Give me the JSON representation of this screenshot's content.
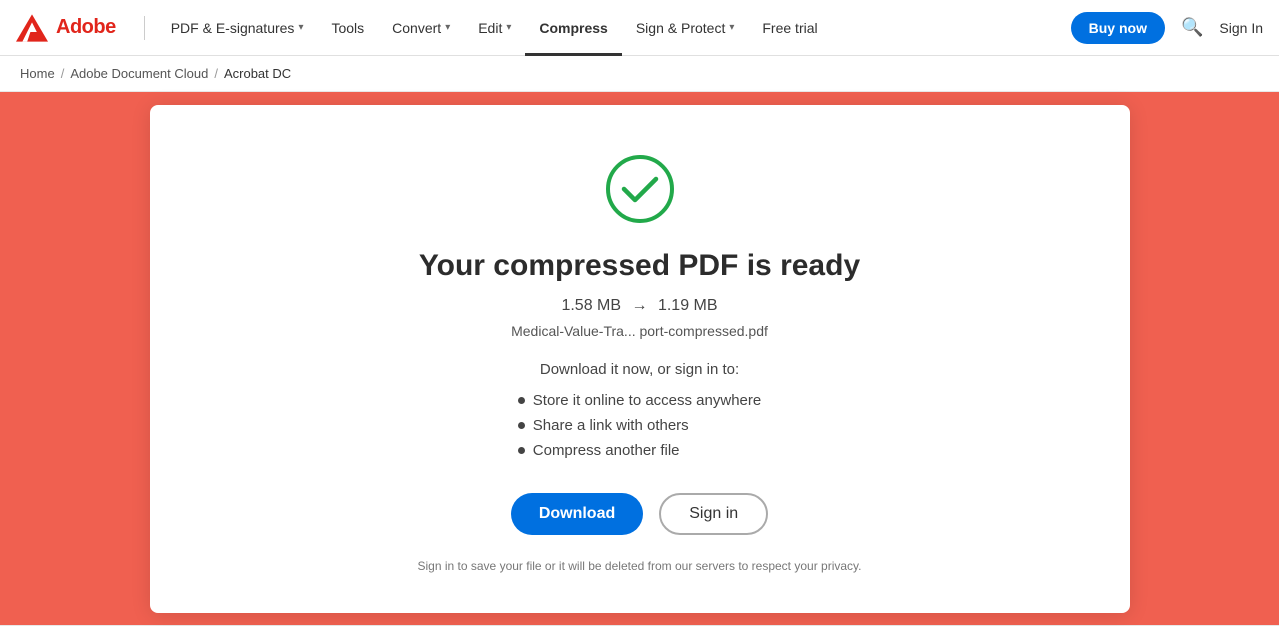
{
  "brand": {
    "adobe_icon_alt": "Adobe",
    "wordmark": "Adobe"
  },
  "navbar": {
    "items": [
      {
        "label": "PDF & E-signatures",
        "has_dropdown": true,
        "active": false
      },
      {
        "label": "Tools",
        "has_dropdown": false,
        "active": false
      },
      {
        "label": "Convert",
        "has_dropdown": true,
        "active": false
      },
      {
        "label": "Edit",
        "has_dropdown": true,
        "active": false
      },
      {
        "label": "Compress",
        "has_dropdown": false,
        "active": true
      },
      {
        "label": "Sign & Protect",
        "has_dropdown": true,
        "active": false
      },
      {
        "label": "Free trial",
        "has_dropdown": false,
        "active": false
      }
    ],
    "buy_now_label": "Buy now",
    "sign_in_label": "Sign In"
  },
  "breadcrumb": {
    "items": [
      {
        "label": "Home",
        "link": true
      },
      {
        "label": "Adobe Document Cloud",
        "link": true
      },
      {
        "label": "Acrobat DC",
        "link": false
      }
    ]
  },
  "card": {
    "check_icon_color": "#22a94a",
    "title": "Your compressed PDF is ready",
    "original_size": "1.58 MB",
    "arrow": "→",
    "compressed_size": "1.19 MB",
    "filename": "Medical-Value-Tra... port-compressed.pdf",
    "download_prompt": "Download it now, or sign in to:",
    "features": [
      "Store it online to access anywhere",
      "Share a link with others",
      "Compress another file"
    ],
    "download_btn_label": "Download",
    "signin_btn_label": "Sign in",
    "privacy_note": "Sign in to save your file or it will be deleted from our servers to respect your privacy."
  }
}
